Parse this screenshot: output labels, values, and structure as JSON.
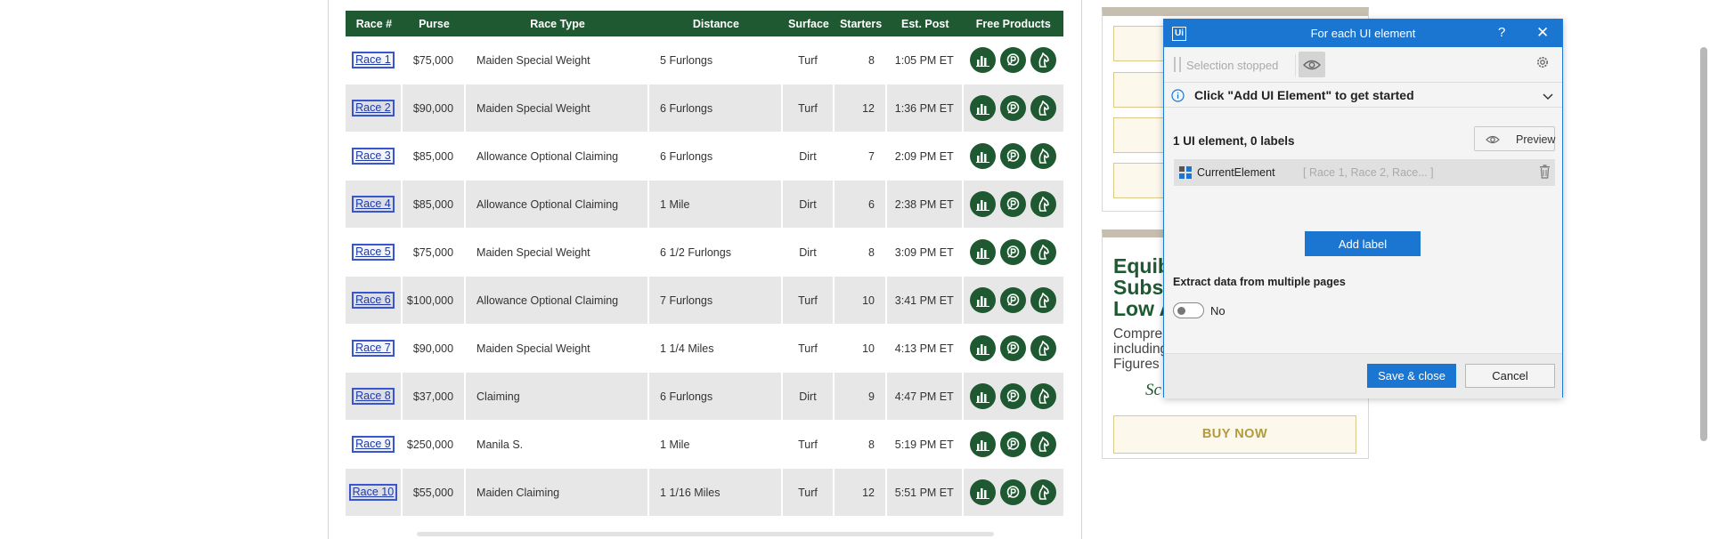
{
  "table": {
    "headers": [
      "Race #",
      "Purse",
      "Race Type",
      "Distance",
      "Surface",
      "Starters",
      "Est. Post",
      "Free Products"
    ],
    "rows": [
      {
        "race": "Race 1",
        "purse": "$75,000",
        "type": "Maiden Special Weight",
        "distance": "5 Furlongs",
        "surface": "Turf",
        "starters": "8",
        "post": "1:05 PM ET"
      },
      {
        "race": "Race 2",
        "purse": "$90,000",
        "type": "Maiden Special Weight",
        "distance": "6 Furlongs",
        "surface": "Turf",
        "starters": "12",
        "post": "1:36 PM ET"
      },
      {
        "race": "Race 3",
        "purse": "$85,000",
        "type": "Allowance Optional Claiming",
        "distance": "6 Furlongs",
        "surface": "Dirt",
        "starters": "7",
        "post": "2:09 PM ET"
      },
      {
        "race": "Race 4",
        "purse": "$85,000",
        "type": "Allowance Optional Claiming",
        "distance": "1 Mile",
        "surface": "Dirt",
        "starters": "6",
        "post": "2:38 PM ET"
      },
      {
        "race": "Race 5",
        "purse": "$75,000",
        "type": "Maiden Special Weight",
        "distance": "6 1/2 Furlongs",
        "surface": "Dirt",
        "starters": "8",
        "post": "3:09 PM ET"
      },
      {
        "race": "Race 6",
        "purse": "$100,000",
        "type": "Allowance Optional Claiming",
        "distance": "7 Furlongs",
        "surface": "Turf",
        "starters": "10",
        "post": "3:41 PM ET"
      },
      {
        "race": "Race 7",
        "purse": "$90,000",
        "type": "Maiden Special Weight",
        "distance": "1 1/4 Miles",
        "surface": "Turf",
        "starters": "10",
        "post": "4:13 PM ET"
      },
      {
        "race": "Race 8",
        "purse": "$37,000",
        "type": "Claiming",
        "distance": "6 Furlongs",
        "surface": "Dirt",
        "starters": "9",
        "post": "4:47 PM ET"
      },
      {
        "race": "Race 9",
        "purse": "$250,000",
        "type": "Manila S.",
        "distance": "1 Mile",
        "surface": "Turf",
        "starters": "8",
        "post": "5:19 PM ET"
      },
      {
        "race": "Race 10",
        "purse": "$55,000",
        "type": "Maiden Claiming",
        "distance": "1 1/16 Miles",
        "surface": "Turf",
        "starters": "12",
        "post": "5:51 PM ET"
      }
    ],
    "product_icons": [
      "bar-chart-icon",
      "dollar-p-icon",
      "horse-head-icon"
    ]
  },
  "ad": {
    "headline": "Equib\nSubsc\nLow A",
    "body": "Compre\nincluding\nFigures",
    "script": "Sc",
    "buy_label": "BUY NOW"
  },
  "dialog": {
    "title": "For each UI element",
    "logo": "Ui",
    "help": "?",
    "close": "✕",
    "selection_status": "Selection stopped",
    "info": "Click \"Add UI Element\" to get started",
    "count": "1 UI element, 0 labels",
    "preview_label": "Preview",
    "element_name": "CurrentElement",
    "element_values": "[ Race 1, Race 2, Race... ]",
    "add_label": "Add label",
    "extract_label": "Extract data from multiple pages",
    "toggle_state": "No",
    "save_label": "Save & close",
    "cancel_label": "Cancel"
  },
  "colors": {
    "table_header": "#1e5931",
    "product_button": "#1e5931",
    "dialog_accent": "#1b76d2",
    "link": "#1f3aa8"
  }
}
